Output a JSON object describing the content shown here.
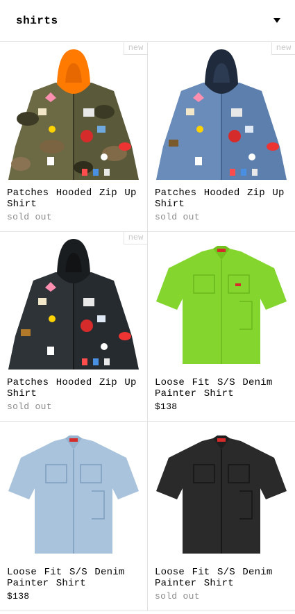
{
  "header": {
    "category": "shirts"
  },
  "products": [
    {
      "name": "Patches Hooded Zip Up Shirt",
      "badge": "new",
      "status": "sold out",
      "color": "camo",
      "image": "camo-jacket-with-orange-hood"
    },
    {
      "name": "Patches Hooded Zip Up Shirt",
      "badge": "new",
      "status": "sold out",
      "color": "denim",
      "image": "denim-jacket-with-navy-hood"
    },
    {
      "name": "Patches Hooded Zip Up Shirt",
      "badge": "new",
      "status": "sold out",
      "color": "black",
      "image": "black-jacket-with-black-hood"
    },
    {
      "name": "Loose Fit S/S Denim Painter Shirt",
      "price": "$138",
      "color": "lime",
      "image": "lime-short-sleeve-shirt"
    },
    {
      "name": "Loose Fit S/S Denim Painter Shirt",
      "price": "$138",
      "color": "light-denim",
      "image": "washed-denim-short-sleeve-shirt"
    },
    {
      "name": "Loose Fit S/S Denim Painter Shirt",
      "status": "sold out",
      "color": "black",
      "image": "black-short-sleeve-shirt"
    }
  ],
  "colors": {
    "border": "#e2e2e2",
    "sold_out": "#8a8a8a",
    "badge": "#c8c8c8"
  }
}
